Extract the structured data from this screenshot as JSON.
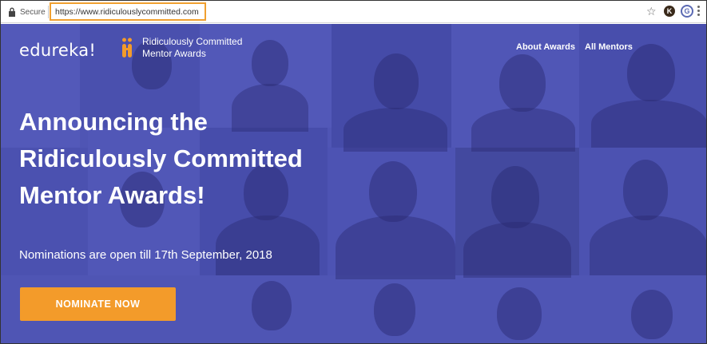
{
  "browser": {
    "secure_label": "Secure",
    "url": "https://www.ridiculouslycommitted.com",
    "icons": [
      "lock-icon",
      "star-icon",
      "extension-k-icon",
      "extension-g-icon",
      "menu-icon"
    ],
    "extension_k_letter": "K",
    "extension_g_letter": "G"
  },
  "header": {
    "brand": "edureka!",
    "award_title": "Ridiculously Committed Mentor Awards",
    "nav": [
      {
        "label": "About Awards"
      },
      {
        "label": "All Mentors"
      }
    ]
  },
  "hero": {
    "headline_line1": "Announcing the",
    "headline_line2": "Ridiculously Committed",
    "headline_line3": "Mentor Awards!",
    "subline": "Nominations are open till 17th September, 2018",
    "cta_label": "NOMINATE NOW"
  },
  "colors": {
    "hero_overlay": "#4f55b4",
    "cta": "#f39b2a",
    "url_highlight": "#f0a030",
    "logo_orange": "#f39b2a"
  }
}
